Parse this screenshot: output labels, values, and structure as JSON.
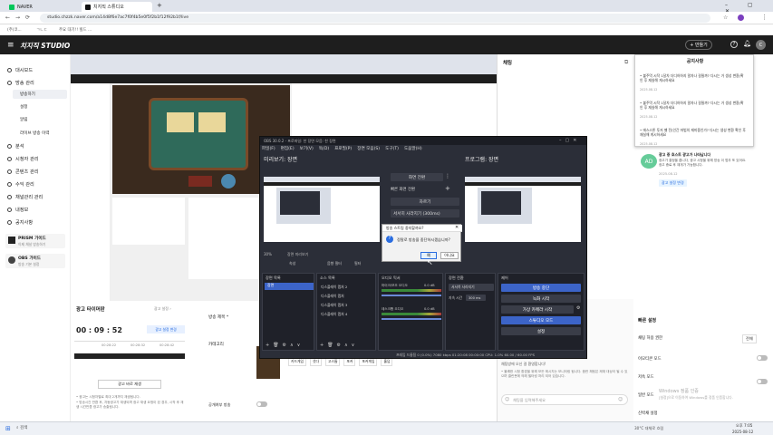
{
  "browser": {
    "tabs": [
      {
        "label": "NAVER"
      },
      {
        "label": "치지직 스튜디오"
      }
    ],
    "url": "studio.chzzk.naver.com/a14d8f6e7ac7f0f4b5e0f5f2b1f12f92b1f/live",
    "bookmarks": [
      "(주)코...",
      "ㄱㄴㄷ",
      "주요 대기!! 빌드 ..."
    ]
  },
  "app": {
    "logo": "치지직 STUDIO",
    "top_button": "+ 만들기",
    "user_initial": "C"
  },
  "sidebar": {
    "items": [
      {
        "label": "대시보드"
      },
      {
        "label": "방송 관리"
      },
      {
        "label": "방송하기"
      },
      {
        "label": "설정"
      },
      {
        "label": "알림"
      },
      {
        "label": "라이브 방송 이력"
      },
      {
        "label": "분석"
      },
      {
        "label": "시청자 관리"
      },
      {
        "label": "콘텐츠 관리"
      },
      {
        "label": "수익 관리"
      },
      {
        "label": "채널관리 관리"
      },
      {
        "label": "내정보"
      },
      {
        "label": "공지사항"
      }
    ],
    "cards": [
      {
        "title": "PRISM 가이드",
        "sub": "이제 채널 방송하기"
      },
      {
        "title": "OBS 가이드",
        "sub": "방송 기본 설정"
      }
    ]
  },
  "main": {
    "section_title": "광고 타이머판",
    "timer_label": "00 : 09 : 52",
    "ad_badge": "광고 설정 변경",
    "ad_button": "광고 바로 재생",
    "category_label": "카테고리",
    "broadcast_title_label": "방송 제목 *",
    "category_value": "카드 게임",
    "toggle_label": "공개여부 방송",
    "tags": [
      "카드게임",
      "섯다",
      "고스톱",
      "포커",
      "포커게임",
      "홀덤"
    ],
    "timeline_ticks": [
      "00:28:22",
      "00:28:32",
      "00:28:42"
    ],
    "note1": "• 광고는 시청자별로 최대 2개까지 재생됩니다.",
    "note2": "• 방송시간 만큼 후, 자동광고가 재생되며 광고 재생 요청이 된 경우, 시작 후 재생 시간만큼 광고가 송출됩니다."
  },
  "obs": {
    "title": "OBS 30.0.2 - 프로파일: 찬 장면 모음: 찬 장면",
    "menu": [
      "파일(F)",
      "편집(E)",
      "보기(V)",
      "독(D)",
      "프로필(P)",
      "장면 모음(S)",
      "도구(T)",
      "도움말(H)"
    ],
    "preview_title": "미리보기: 장면",
    "program_title": "프로그램: 장면",
    "transition_button": "화면 전환",
    "transition_label": "빠른 화면 전환",
    "fade": "자르기",
    "slide": "서서히 사라지기 (300ms)",
    "dialog_title": "방송 스트림 중지할까요?",
    "dialog_text": "정말로 방송을 중단하시겠습니까?",
    "dialog_yes": "예",
    "dialog_no": "아니요",
    "zoom": "30%",
    "preview_select": "장면 미리보기",
    "tab_filter": "음향 필터",
    "tab_props": "속성",
    "tab_filters2": "필터",
    "dock_scenes": "장면 목록",
    "dock_sources": "소스 목록",
    "dock_mixer": "오디오 믹서",
    "dock_transitions": "장면 전환",
    "dock_controls": "제어",
    "scene_item": "장면",
    "sources": [
      "디스플레이 캡처 2",
      "디스플레이 캡처",
      "디스플레이 캡처 3",
      "디스플레이 캡처 4"
    ],
    "mixer_tracks": [
      {
        "name": "마이크/보조 오디오",
        "db": "0.0 dB"
      },
      {
        "name": "데스크톱 오디오",
        "db": "0.0 dB"
      }
    ],
    "transition_value": "서서히 사라지기",
    "duration_label": "지속 시간",
    "duration_value": "300 ms",
    "controls": [
      "방송 중단",
      "녹화 시작",
      "가상 카메라 시작",
      "스튜디오 모드",
      "설정"
    ],
    "status": "프레임 드롭됨 0 (0.0%)   7080 kbps   01:20:08   00:00:00   CPU: 1.0%   60.00 / 60.00 FPS"
  },
  "chat": {
    "title": "채팅",
    "notif_title": "공지사항",
    "notif_items": [
      {
        "text": "• 불주먹 시작 1달차 더디하하지 말자나 걸릴까? 다시는 거 생성 변환(확인 후 재실해 게시하세요",
        "date": "2025.08.12"
      },
      {
        "text": "• 불주먹 시작 1달차 더디하하지 말자나 걸릴까? 다시는 거 생성 변환(확인 후 재실해 게시하세요",
        "date": "2025.08.12"
      },
      {
        "text": "• 에스스톤 투저 벨 전(인간 마법의 재미중인가? 다시는 생성 변환 확인 후 재실해 게시하세요",
        "date": "2025.08.12"
      }
    ],
    "ad_user": "AD",
    "ad_title": "광고 중 호스트 광고가 나타납니다",
    "ad_text": "광고가 결정을 줍니다, 광고 시청을 위해 방송 이 멈추 또 있어요. 광고 종료 후 재개가 가능합니다.",
    "ad_date": "2025.08.12",
    "ad_button": "광고 설정 변경",
    "quick_title": "빠른 설정",
    "settings": [
      {
        "label": "채팅 허용 권한",
        "value": "전체"
      },
      {
        "label": "이모티콘 모드",
        "value": ""
      },
      {
        "label": "저속 모드",
        "value": ""
      },
      {
        "label": "일반 모드",
        "value": ""
      },
      {
        "label": "신박채 설정",
        "value": ""
      }
    ],
    "system_msg": "채팅방에 오신 걸 환영합니다!",
    "system_msg2": "• 불쾌한 시청 환경을 위해 모든 메시지는 모니터링 됩니다. 음란 채팅은 제재 대상이 될 수 있으며 클린봇에 의해 필터링 처리 되어 있습니다.",
    "chat_placeholder": "채팅을 입력해주세요",
    "watermark1": "Windows 정품 인증",
    "watermark2": "[설정]으로 이동하여 Windows를 정품 인증합니다."
  },
  "taskbar": {
    "search": "검색",
    "temp": "30°C 대체로 흐림",
    "time": "오후 7:05",
    "date": "2025-08-12"
  },
  "colors": {
    "accent": "#3c64c8",
    "green": "#03c75a",
    "obs_bg": "#2b2e38"
  }
}
